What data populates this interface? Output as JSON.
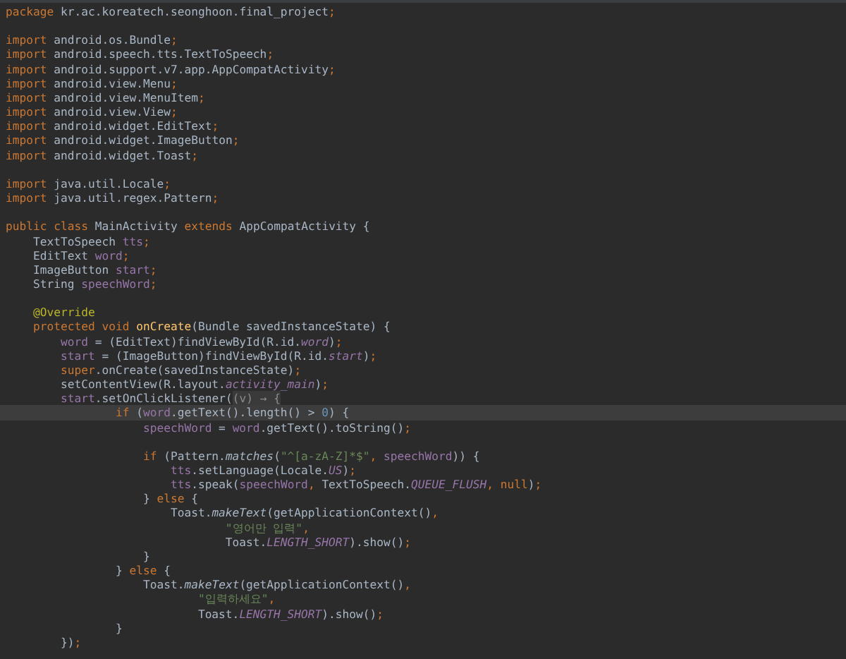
{
  "editor": {
    "lines": [
      {
        "kind": "code",
        "current": false,
        "tokens": [
          {
            "text": "package",
            "kind": "k"
          },
          {
            "text": " kr.ac.koreatech.seonghoon.final_project",
            "kind": "p"
          },
          {
            "text": ";",
            "kind": "k"
          }
        ]
      },
      {
        "kind": "blank"
      },
      {
        "kind": "code",
        "current": false,
        "tokens": [
          {
            "text": "import",
            "kind": "k"
          },
          {
            "text": " android.os.Bundle",
            "kind": "p"
          },
          {
            "text": ";",
            "kind": "k"
          }
        ]
      },
      {
        "kind": "code",
        "current": false,
        "tokens": [
          {
            "text": "import",
            "kind": "k"
          },
          {
            "text": " android.speech.tts.TextToSpeech",
            "kind": "p"
          },
          {
            "text": ";",
            "kind": "k"
          }
        ]
      },
      {
        "kind": "code",
        "current": false,
        "tokens": [
          {
            "text": "import",
            "kind": "k"
          },
          {
            "text": " android.support.v7.app.AppCompatActivity",
            "kind": "p"
          },
          {
            "text": ";",
            "kind": "k"
          }
        ]
      },
      {
        "kind": "code",
        "current": false,
        "tokens": [
          {
            "text": "import",
            "kind": "k"
          },
          {
            "text": " android.view.Menu",
            "kind": "p"
          },
          {
            "text": ";",
            "kind": "k"
          }
        ]
      },
      {
        "kind": "code",
        "current": false,
        "tokens": [
          {
            "text": "import",
            "kind": "k"
          },
          {
            "text": " android.view.MenuItem",
            "kind": "p"
          },
          {
            "text": ";",
            "kind": "k"
          }
        ]
      },
      {
        "kind": "code",
        "current": false,
        "tokens": [
          {
            "text": "import",
            "kind": "k"
          },
          {
            "text": " android.view.View",
            "kind": "p"
          },
          {
            "text": ";",
            "kind": "k"
          }
        ]
      },
      {
        "kind": "code",
        "current": false,
        "tokens": [
          {
            "text": "import",
            "kind": "k"
          },
          {
            "text": " android.widget.EditText",
            "kind": "p"
          },
          {
            "text": ";",
            "kind": "k"
          }
        ]
      },
      {
        "kind": "code",
        "current": false,
        "tokens": [
          {
            "text": "import",
            "kind": "k"
          },
          {
            "text": " android.widget.ImageButton",
            "kind": "p"
          },
          {
            "text": ";",
            "kind": "k"
          }
        ]
      },
      {
        "kind": "code",
        "current": false,
        "tokens": [
          {
            "text": "import",
            "kind": "k"
          },
          {
            "text": " android.widget.Toast",
            "kind": "p"
          },
          {
            "text": ";",
            "kind": "k"
          }
        ]
      },
      {
        "kind": "blank"
      },
      {
        "kind": "code",
        "current": false,
        "tokens": [
          {
            "text": "import",
            "kind": "k"
          },
          {
            "text": " java.util.Locale",
            "kind": "p"
          },
          {
            "text": ";",
            "kind": "k"
          }
        ]
      },
      {
        "kind": "code",
        "current": false,
        "tokens": [
          {
            "text": "import",
            "kind": "k"
          },
          {
            "text": " java.util.regex.Pattern",
            "kind": "p"
          },
          {
            "text": ";",
            "kind": "k"
          }
        ]
      },
      {
        "kind": "blank"
      },
      {
        "kind": "code",
        "current": false,
        "tokens": [
          {
            "text": "public class",
            "kind": "k"
          },
          {
            "text": " MainActivity ",
            "kind": "p"
          },
          {
            "text": "extends",
            "kind": "k"
          },
          {
            "text": " AppCompatActivity {",
            "kind": "p"
          }
        ]
      },
      {
        "kind": "code",
        "current": false,
        "tokens": [
          {
            "text": "    TextToSpeech ",
            "kind": "p"
          },
          {
            "text": "tts",
            "kind": "f"
          },
          {
            "text": ";",
            "kind": "k"
          }
        ]
      },
      {
        "kind": "code",
        "current": false,
        "tokens": [
          {
            "text": "    EditText ",
            "kind": "p"
          },
          {
            "text": "word",
            "kind": "f"
          },
          {
            "text": ";",
            "kind": "k"
          }
        ]
      },
      {
        "kind": "code",
        "current": false,
        "tokens": [
          {
            "text": "    ImageButton ",
            "kind": "p"
          },
          {
            "text": "start",
            "kind": "f"
          },
          {
            "text": ";",
            "kind": "k"
          }
        ]
      },
      {
        "kind": "code",
        "current": false,
        "tokens": [
          {
            "text": "    String ",
            "kind": "p"
          },
          {
            "text": "speechWord",
            "kind": "f"
          },
          {
            "text": ";",
            "kind": "k"
          }
        ]
      },
      {
        "kind": "blank"
      },
      {
        "kind": "code",
        "current": false,
        "tokens": [
          {
            "text": "    @Override",
            "kind": "a"
          }
        ]
      },
      {
        "kind": "code",
        "current": false,
        "tokens": [
          {
            "text": "    protected void ",
            "kind": "k"
          },
          {
            "text": "onCreate",
            "kind": "d"
          },
          {
            "text": "(Bundle savedInstanceState) {",
            "kind": "p"
          }
        ]
      },
      {
        "kind": "code",
        "current": false,
        "tokens": [
          {
            "text": "        word",
            "kind": "f"
          },
          {
            "text": " = (EditText)findViewById(R.id.",
            "kind": "p"
          },
          {
            "text": "word",
            "kind": "fi"
          },
          {
            "text": ")",
            "kind": "p"
          },
          {
            "text": ";",
            "kind": "k"
          }
        ]
      },
      {
        "kind": "code",
        "current": false,
        "tokens": [
          {
            "text": "        start",
            "kind": "f"
          },
          {
            "text": " = (ImageButton)findViewById(R.id.",
            "kind": "p"
          },
          {
            "text": "start",
            "kind": "fi"
          },
          {
            "text": ")",
            "kind": "p"
          },
          {
            "text": ";",
            "kind": "k"
          }
        ]
      },
      {
        "kind": "code",
        "current": false,
        "tokens": [
          {
            "text": "        super",
            "kind": "k"
          },
          {
            "text": ".onCreate(savedInstanceState)",
            "kind": "p"
          },
          {
            "text": ";",
            "kind": "k"
          }
        ]
      },
      {
        "kind": "code",
        "current": false,
        "tokens": [
          {
            "text": "        setContentView(R.layout.",
            "kind": "p"
          },
          {
            "text": "activity_main",
            "kind": "fi"
          },
          {
            "text": ")",
            "kind": "p"
          },
          {
            "text": ";",
            "kind": "k"
          }
        ]
      },
      {
        "kind": "code",
        "current": false,
        "tokens": [
          {
            "text": "        start",
            "kind": "f"
          },
          {
            "text": ".setOnClickListener(",
            "kind": "p"
          },
          {
            "text": "(v) → {",
            "kind": "g"
          }
        ]
      },
      {
        "kind": "code",
        "current": true,
        "tokens": [
          {
            "text": "                if",
            "kind": "k"
          },
          {
            "text": " (",
            "kind": "p"
          },
          {
            "text": "word",
            "kind": "f"
          },
          {
            "text": ".getText().length() > ",
            "kind": "p"
          },
          {
            "text": "0",
            "kind": "n"
          },
          {
            "text": ") {",
            "kind": "p"
          }
        ]
      },
      {
        "kind": "code",
        "current": false,
        "tokens": [
          {
            "text": "                    speechWord",
            "kind": "f"
          },
          {
            "text": " = ",
            "kind": "p"
          },
          {
            "text": "word",
            "kind": "f"
          },
          {
            "text": ".getText().toString()",
            "kind": "p"
          },
          {
            "text": ";",
            "kind": "k"
          }
        ]
      },
      {
        "kind": "blank"
      },
      {
        "kind": "code",
        "current": false,
        "tokens": [
          {
            "text": "                    if",
            "kind": "k"
          },
          {
            "text": " (Pattern.",
            "kind": "p"
          },
          {
            "text": "matches",
            "kind": "mi"
          },
          {
            "text": "(",
            "kind": "p"
          },
          {
            "text": "\"^[a-zA-Z]*$\"",
            "kind": "s"
          },
          {
            "text": ", ",
            "kind": "k"
          },
          {
            "text": "speechWord",
            "kind": "f"
          },
          {
            "text": ")) {",
            "kind": "p"
          }
        ]
      },
      {
        "kind": "code",
        "current": false,
        "tokens": [
          {
            "text": "                        tts",
            "kind": "f"
          },
          {
            "text": ".setLanguage(Locale.",
            "kind": "p"
          },
          {
            "text": "US",
            "kind": "fi"
          },
          {
            "text": ")",
            "kind": "p"
          },
          {
            "text": ";",
            "kind": "k"
          }
        ]
      },
      {
        "kind": "code",
        "current": false,
        "tokens": [
          {
            "text": "                        tts",
            "kind": "f"
          },
          {
            "text": ".speak(",
            "kind": "p"
          },
          {
            "text": "speechWord",
            "kind": "f"
          },
          {
            "text": ", ",
            "kind": "k"
          },
          {
            "text": "TextToSpeech.",
            "kind": "p"
          },
          {
            "text": "QUEUE_FLUSH",
            "kind": "fi"
          },
          {
            "text": ", ",
            "kind": "k"
          },
          {
            "text": "null",
            "kind": "k"
          },
          {
            "text": ")",
            "kind": "p"
          },
          {
            "text": ";",
            "kind": "k"
          }
        ]
      },
      {
        "kind": "code",
        "current": false,
        "tokens": [
          {
            "text": "                    } ",
            "kind": "p"
          },
          {
            "text": "else",
            "kind": "k"
          },
          {
            "text": " {",
            "kind": "p"
          }
        ]
      },
      {
        "kind": "code",
        "current": false,
        "tokens": [
          {
            "text": "                        Toast.",
            "kind": "p"
          },
          {
            "text": "makeText",
            "kind": "mi"
          },
          {
            "text": "(getApplicationContext()",
            "kind": "p"
          },
          {
            "text": ",",
            "kind": "k"
          }
        ]
      },
      {
        "kind": "code",
        "current": false,
        "tokens": [
          {
            "text": "                                \"영어만 입력\"",
            "kind": "s"
          },
          {
            "text": ",",
            "kind": "k"
          }
        ]
      },
      {
        "kind": "code",
        "current": false,
        "tokens": [
          {
            "text": "                                Toast.",
            "kind": "p"
          },
          {
            "text": "LENGTH_SHORT",
            "kind": "fi"
          },
          {
            "text": ").show()",
            "kind": "p"
          },
          {
            "text": ";",
            "kind": "k"
          }
        ]
      },
      {
        "kind": "code",
        "current": false,
        "tokens": [
          {
            "text": "                    }",
            "kind": "p"
          }
        ]
      },
      {
        "kind": "code",
        "current": false,
        "tokens": [
          {
            "text": "                } ",
            "kind": "p"
          },
          {
            "text": "else",
            "kind": "k"
          },
          {
            "text": " {",
            "kind": "p"
          }
        ]
      },
      {
        "kind": "code",
        "current": false,
        "tokens": [
          {
            "text": "                    Toast.",
            "kind": "p"
          },
          {
            "text": "makeText",
            "kind": "mi"
          },
          {
            "text": "(getApplicationContext()",
            "kind": "p"
          },
          {
            "text": ",",
            "kind": "k"
          }
        ]
      },
      {
        "kind": "code",
        "current": false,
        "tokens": [
          {
            "text": "                            \"입력하세요\"",
            "kind": "s"
          },
          {
            "text": ",",
            "kind": "k"
          }
        ]
      },
      {
        "kind": "code",
        "current": false,
        "tokens": [
          {
            "text": "                            Toast.",
            "kind": "p"
          },
          {
            "text": "LENGTH_SHORT",
            "kind": "fi"
          },
          {
            "text": ").show()",
            "kind": "p"
          },
          {
            "text": ";",
            "kind": "k"
          }
        ]
      },
      {
        "kind": "code",
        "current": false,
        "tokens": [
          {
            "text": "                }",
            "kind": "p"
          }
        ]
      },
      {
        "kind": "code",
        "current": false,
        "tokens": [
          {
            "text": "        })",
            "kind": "p"
          },
          {
            "text": ";",
            "kind": "k"
          }
        ]
      }
    ]
  }
}
